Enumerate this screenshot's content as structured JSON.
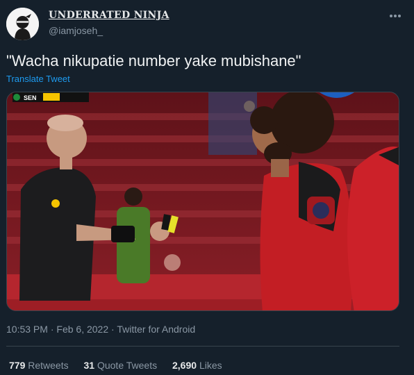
{
  "author": {
    "display_name": "UNDERRATED NINJA",
    "handle": "@iamjoseh_",
    "avatar_icon": "ninja-avatar"
  },
  "tweet": {
    "text": "\"Wacha nikupatie number yake mubishane\"",
    "translate_label": "Translate Tweet",
    "media_icon": "football-photo",
    "scoreboard_team": "SEN",
    "time": "10:53 PM",
    "date": "Feb 6, 2022",
    "source": "Twitter for Android",
    "separator": "·"
  },
  "stats": {
    "retweets_count": "779",
    "retweets_label": "Retweets",
    "quotes_count": "31",
    "quotes_label": "Quote Tweets",
    "likes_count": "2,690",
    "likes_label": "Likes"
  },
  "colors": {
    "background": "#15202b",
    "link": "#1d9bf0",
    "muted": "#8b98a5"
  }
}
